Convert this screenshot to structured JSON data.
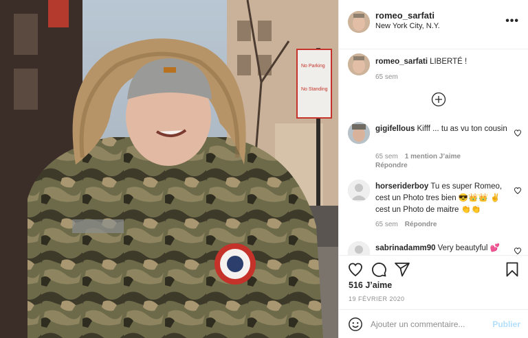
{
  "post": {
    "author": "romeo_sarfati",
    "location": "New York City, N.Y.",
    "caption_user": "romeo_sarfati",
    "caption_text": "LIBERTÉ !",
    "caption_time": "65 sem"
  },
  "photo": {
    "sign_line1": "No Parking",
    "sign_line2": "No Standing"
  },
  "comments": [
    {
      "user": "gigifellous",
      "text": "Kifff ... tu as vu ton cousin",
      "time": "65 sem",
      "likes": "1 mention J’aime",
      "reply": "Répondre"
    },
    {
      "user": "horseriderboy",
      "text": "Tu es super Romeo, cest un Photo tres bien 😎👑👑 ✌️cest un Photo de maitre 👏👏",
      "time": "65 sem",
      "reply": "Répondre"
    },
    {
      "user": "sabrinadamm90",
      "text": "Very beautyful 💕"
    }
  ],
  "actions": {
    "likes": "516 J’aime",
    "date": "19 FÉVRIER 2020",
    "comment_placeholder": "Ajouter un commentaire...",
    "publish": "Publier"
  },
  "icons": [
    "more-icon",
    "heart-icon",
    "comment-icon",
    "share-icon",
    "bookmark-icon",
    "emoji-icon",
    "plus-circle-icon"
  ]
}
